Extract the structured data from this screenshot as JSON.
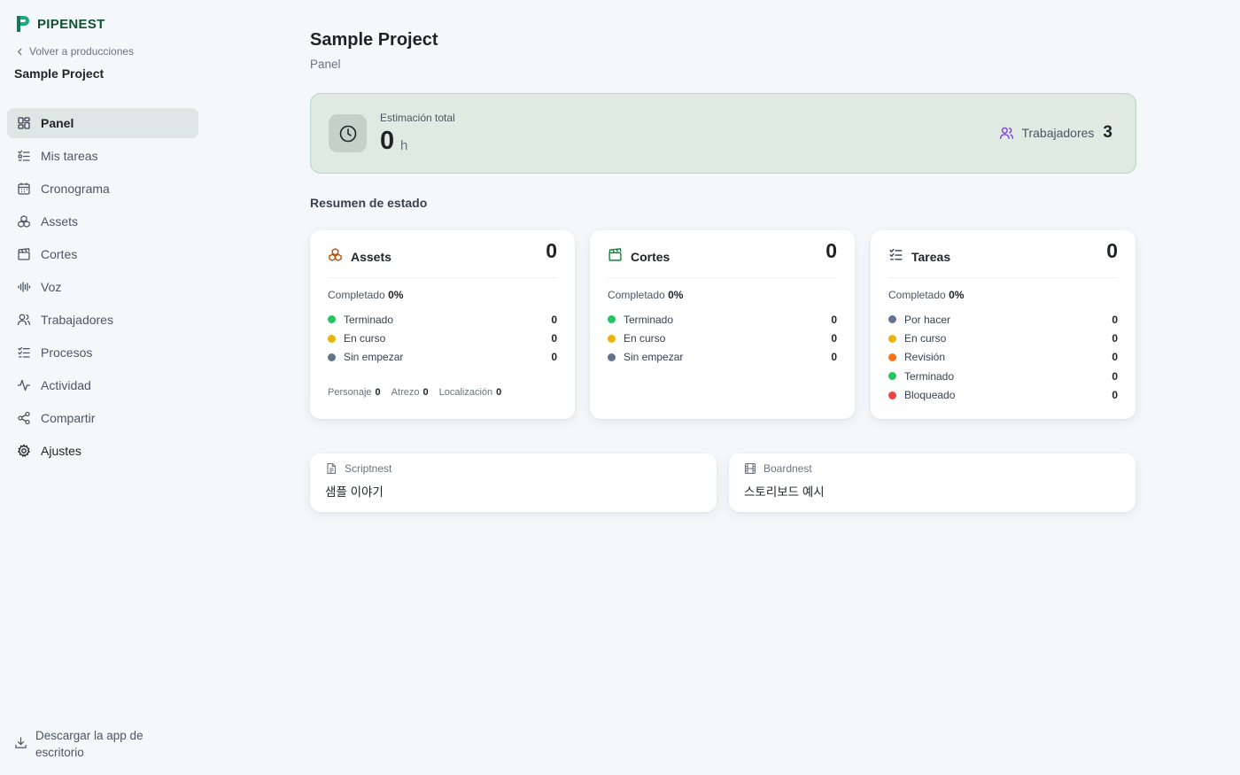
{
  "brand": {
    "name": "PIPENEST"
  },
  "sidebar": {
    "back_label": "Volver a producciones",
    "project_name": "Sample Project",
    "items": [
      {
        "label": "Panel",
        "icon": "dashboard-icon",
        "active": true
      },
      {
        "label": "Mis tareas",
        "icon": "task-list-icon"
      },
      {
        "label": "Cronograma",
        "icon": "calendar-icon"
      },
      {
        "label": "Assets",
        "icon": "assets-icon"
      },
      {
        "label": "Cortes",
        "icon": "clapperboard-icon"
      },
      {
        "label": "Voz",
        "icon": "audio-wave-icon"
      },
      {
        "label": "Trabajadores",
        "icon": "users-icon"
      },
      {
        "label": "Procesos",
        "icon": "process-list-icon"
      },
      {
        "label": "Actividad",
        "icon": "activity-icon"
      },
      {
        "label": "Compartir",
        "icon": "share-icon"
      },
      {
        "label": "Ajustes",
        "icon": "gear-icon"
      }
    ],
    "download_label": "Descargar la app de escritorio"
  },
  "header": {
    "title": "Sample Project",
    "subtitle": "Panel"
  },
  "estimate": {
    "label": "Estimación total",
    "value": "0",
    "unit": "h",
    "workers_label": "Trabajadores",
    "workers_count": "3"
  },
  "status_section_title": "Resumen de estado",
  "cards": [
    {
      "title": "Assets",
      "count": "0",
      "icon": "assets-icon",
      "completed_label": "Completado",
      "completed_value": "0%",
      "statuses": [
        {
          "label": "Terminado",
          "value": "0",
          "color": "#22c55e"
        },
        {
          "label": "En curso",
          "value": "0",
          "color": "#eab308"
        },
        {
          "label": "Sin empezar",
          "value": "0",
          "color": "#64748b"
        }
      ],
      "footer": [
        {
          "label": "Personaje",
          "value": "0"
        },
        {
          "label": "Atrezo",
          "value": "0"
        },
        {
          "label": "Localización",
          "value": "0"
        }
      ]
    },
    {
      "title": "Cortes",
      "count": "0",
      "icon": "clapperboard-icon",
      "completed_label": "Completado",
      "completed_value": "0%",
      "statuses": [
        {
          "label": "Terminado",
          "value": "0",
          "color": "#22c55e"
        },
        {
          "label": "En curso",
          "value": "0",
          "color": "#eab308"
        },
        {
          "label": "Sin empezar",
          "value": "0",
          "color": "#64748b"
        }
      ]
    },
    {
      "title": "Tareas",
      "count": "0",
      "icon": "task-list-icon",
      "completed_label": "Completado",
      "completed_value": "0%",
      "statuses": [
        {
          "label": "Por hacer",
          "value": "0",
          "color": "#64748b"
        },
        {
          "label": "En curso",
          "value": "0",
          "color": "#eab308"
        },
        {
          "label": "Revisión",
          "value": "0",
          "color": "#f97316"
        },
        {
          "label": "Terminado",
          "value": "0",
          "color": "#22c55e"
        },
        {
          "label": "Bloqueado",
          "value": "0",
          "color": "#ef4444"
        }
      ]
    }
  ],
  "links": [
    {
      "app": "Scriptnest",
      "title": "샘플 이야기",
      "icon": "document-icon"
    },
    {
      "app": "Boardnest",
      "title": "스토리보드 예시",
      "icon": "film-icon"
    }
  ],
  "colors": {
    "accent": "#0f5132",
    "brand_green": "#1fa97a",
    "estimate_bg": "#dfeae3"
  }
}
